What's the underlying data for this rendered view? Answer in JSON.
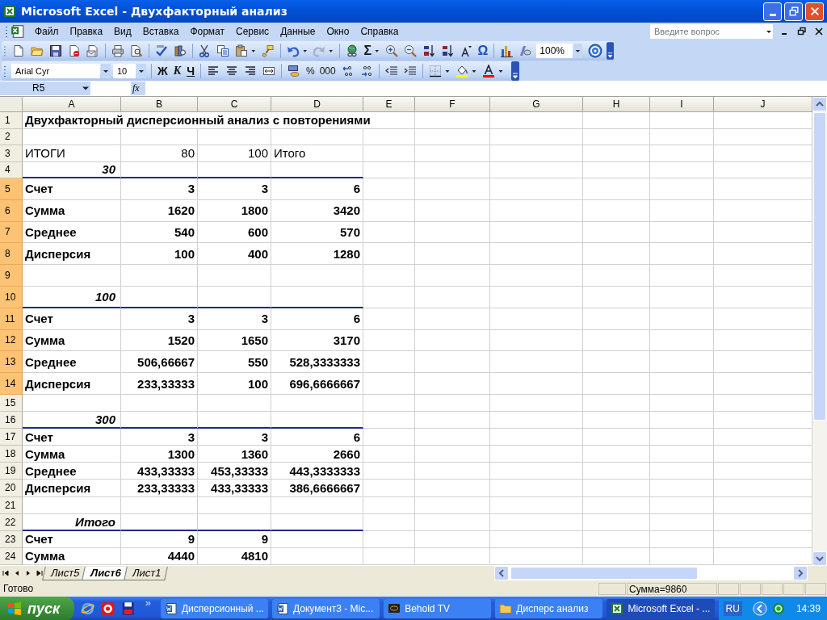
{
  "window": {
    "title": "Microsoft Excel - Двухфакторный анализ"
  },
  "menu": [
    {
      "label": "Файл"
    },
    {
      "label": "Правка"
    },
    {
      "label": "Вид"
    },
    {
      "label": "Вставка"
    },
    {
      "label": "Формат"
    },
    {
      "label": "Сервис"
    },
    {
      "label": "Данные"
    },
    {
      "label": "Окно"
    },
    {
      "label": "Справка"
    }
  ],
  "help_box": {
    "placeholder": "Введите вопрос"
  },
  "standard_toolbar": {
    "autosum": "Σ",
    "symbol": "Ω",
    "zoom": "100%"
  },
  "formatting_toolbar": {
    "font": "Arial Cyr",
    "size": "10",
    "bold": "Ж",
    "italic": "К",
    "underline": "Ч",
    "percent": "%",
    "thousands": "000"
  },
  "formula_bar": {
    "name_box": "R5",
    "function_label": "fx"
  },
  "columns": [
    "A",
    "B",
    "C",
    "D",
    "E",
    "F",
    "G",
    "H",
    "I",
    "J"
  ],
  "rows": [
    {
      "number": "1",
      "selected": false,
      "kind": "title",
      "tall": false,
      "rule_below": false,
      "cells": {
        "A": "Двухфакторный дисперсионный анализ с повторениями"
      }
    },
    {
      "number": "2",
      "selected": false,
      "kind": "blank",
      "tall": false,
      "rule_below": false,
      "cells": {}
    },
    {
      "number": "3",
      "selected": false,
      "kind": "header",
      "tall": false,
      "rule_below": false,
      "cells": {
        "A": "ИТОГИ",
        "B": "80",
        "C": "100",
        "D": "Итого"
      }
    },
    {
      "number": "4",
      "selected": false,
      "kind": "group",
      "tall": false,
      "rule_below": true,
      "cells": {
        "A": "30"
      }
    },
    {
      "number": "5",
      "selected": true,
      "kind": "data",
      "tall": true,
      "rule_below": false,
      "cells": {
        "A": "Счет",
        "B": "3",
        "C": "3",
        "D": "6"
      }
    },
    {
      "number": "6",
      "selected": true,
      "kind": "data",
      "tall": true,
      "rule_below": false,
      "cells": {
        "A": "Сумма",
        "B": "1620",
        "C": "1800",
        "D": "3420"
      }
    },
    {
      "number": "7",
      "selected": true,
      "kind": "data",
      "tall": true,
      "rule_below": false,
      "cells": {
        "A": "Среднее",
        "B": "540",
        "C": "600",
        "D": "570"
      }
    },
    {
      "number": "8",
      "selected": true,
      "kind": "data",
      "tall": true,
      "rule_below": false,
      "cells": {
        "A": "Дисперсия",
        "B": "100",
        "C": "400",
        "D": "1280"
      }
    },
    {
      "number": "9",
      "selected": true,
      "kind": "blank",
      "tall": true,
      "rule_below": false,
      "cells": {}
    },
    {
      "number": "10",
      "selected": true,
      "kind": "group",
      "tall": true,
      "rule_below": true,
      "cells": {
        "A": "100"
      }
    },
    {
      "number": "11",
      "selected": true,
      "kind": "data",
      "tall": true,
      "rule_below": false,
      "cells": {
        "A": "Счет",
        "B": "3",
        "C": "3",
        "D": "6"
      }
    },
    {
      "number": "12",
      "selected": true,
      "kind": "data",
      "tall": true,
      "rule_below": false,
      "cells": {
        "A": "Сумма",
        "B": "1520",
        "C": "1650",
        "D": "3170"
      }
    },
    {
      "number": "13",
      "selected": true,
      "kind": "data",
      "tall": true,
      "rule_below": false,
      "cells": {
        "A": "Среднее",
        "B": "506,66667",
        "C": "550",
        "D": "528,3333333"
      }
    },
    {
      "number": "14",
      "selected": true,
      "kind": "data",
      "tall": true,
      "rule_below": false,
      "cells": {
        "A": "Дисперсия",
        "B": "233,33333",
        "C": "100",
        "D": "696,6666667"
      }
    },
    {
      "number": "15",
      "selected": false,
      "kind": "blank",
      "tall": false,
      "rule_below": false,
      "cells": {}
    },
    {
      "number": "16",
      "selected": false,
      "kind": "group",
      "tall": false,
      "rule_below": true,
      "cells": {
        "A": "300"
      }
    },
    {
      "number": "17",
      "selected": false,
      "kind": "data",
      "tall": false,
      "rule_below": false,
      "cells": {
        "A": "Счет",
        "B": "3",
        "C": "3",
        "D": "6"
      }
    },
    {
      "number": "18",
      "selected": false,
      "kind": "data",
      "tall": false,
      "rule_below": false,
      "cells": {
        "A": "Сумма",
        "B": "1300",
        "C": "1360",
        "D": "2660"
      }
    },
    {
      "number": "19",
      "selected": false,
      "kind": "data",
      "tall": false,
      "rule_below": false,
      "cells": {
        "A": "Среднее",
        "B": "433,33333",
        "C": "453,33333",
        "D": "443,3333333"
      }
    },
    {
      "number": "20",
      "selected": false,
      "kind": "data",
      "tall": false,
      "rule_below": false,
      "cells": {
        "A": "Дисперсия",
        "B": "233,33333",
        "C": "433,33333",
        "D": "386,6666667"
      }
    },
    {
      "number": "21",
      "selected": false,
      "kind": "blank",
      "tall": false,
      "rule_below": false,
      "cells": {}
    },
    {
      "number": "22",
      "selected": false,
      "kind": "group",
      "tall": false,
      "rule_below": true,
      "cells": {
        "A": "Итого"
      }
    },
    {
      "number": "23",
      "selected": false,
      "kind": "data",
      "tall": false,
      "rule_below": false,
      "cells": {
        "A": "Счет",
        "B": "9",
        "C": "9"
      }
    },
    {
      "number": "24",
      "selected": false,
      "kind": "data",
      "tall": false,
      "rule_below": false,
      "cells": {
        "A": "Сумма",
        "B": "4440",
        "C": "4810"
      }
    }
  ],
  "sheet_tabs": [
    {
      "label": "Лист5",
      "selected": false
    },
    {
      "label": "Лист6",
      "selected": true
    },
    {
      "label": "Лист1",
      "selected": false
    }
  ],
  "status_bar": {
    "state": "Готово",
    "sum": "Сумма=9860"
  },
  "taskbar": {
    "start": "пуск",
    "more": "»",
    "tasks": [
      {
        "label": "Дисперсионный ...",
        "kind": "word",
        "selected": false
      },
      {
        "label": "Документ3 - Mic...",
        "kind": "word",
        "selected": false
      },
      {
        "label": "Behold TV",
        "kind": "tv",
        "selected": false
      },
      {
        "label": "Дисперс анализ",
        "kind": "folder",
        "selected": false
      },
      {
        "label": "Microsoft Excel - ...",
        "kind": "excel",
        "selected": true
      }
    ],
    "language": "RU",
    "clock": "14:39"
  }
}
